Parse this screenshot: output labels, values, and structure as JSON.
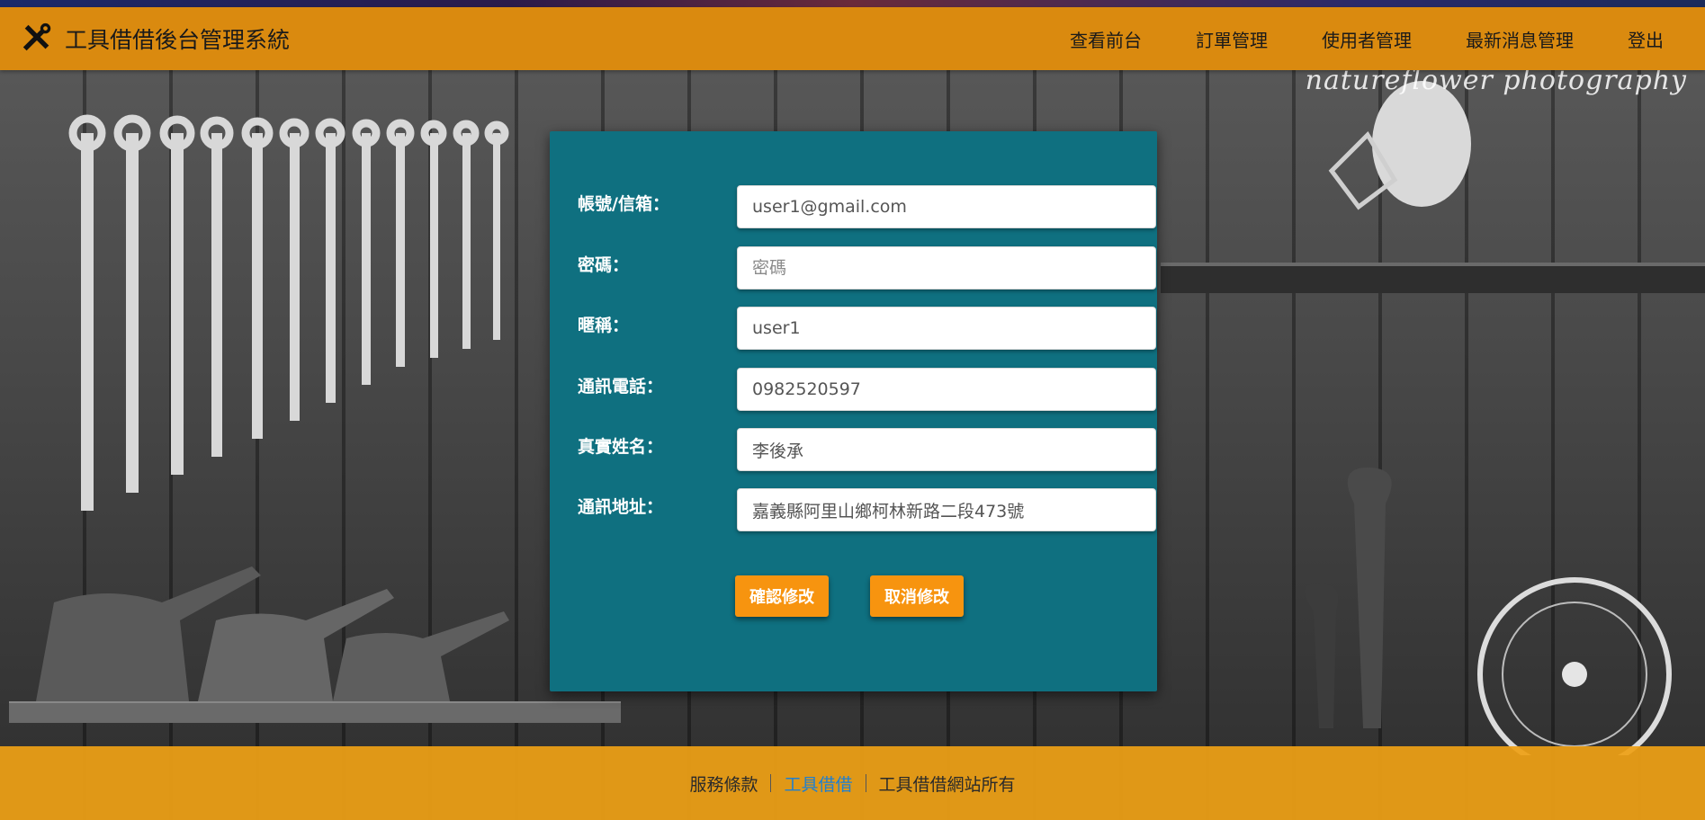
{
  "header": {
    "brand_title": "工具借借後台管理系統",
    "nav": [
      "查看前台",
      "訂單管理",
      "使用者管理",
      "最新消息管理",
      "登出"
    ]
  },
  "background": {
    "watermark": "natureflower photography"
  },
  "form": {
    "fields": [
      {
        "label": "帳號/信箱：",
        "value": "user1@gmail.com",
        "placeholder": ""
      },
      {
        "label": "密碼：",
        "value": "",
        "placeholder": "密碼"
      },
      {
        "label": "暱稱：",
        "value": "user1",
        "placeholder": ""
      },
      {
        "label": "通訊電話：",
        "value": "0982520597",
        "placeholder": ""
      },
      {
        "label": "真實姓名：",
        "value": "李後承",
        "placeholder": ""
      },
      {
        "label": "通訊地址：",
        "value": "嘉義縣阿里山鄉柯林新路二段473號",
        "placeholder": ""
      }
    ],
    "confirm_label": "確認修改",
    "cancel_label": "取消修改"
  },
  "footer": {
    "terms": "服務條款",
    "brand_link": "工具借借",
    "copyright": "工具借借網站所有"
  },
  "colors": {
    "header_bg": "#da8a0f",
    "panel_bg": "#0f7080",
    "button_bg": "#f7940f",
    "footer_bg": "#eea016",
    "footer_link": "#1f7fd0"
  },
  "icons": {
    "brand": "tools-icon"
  }
}
